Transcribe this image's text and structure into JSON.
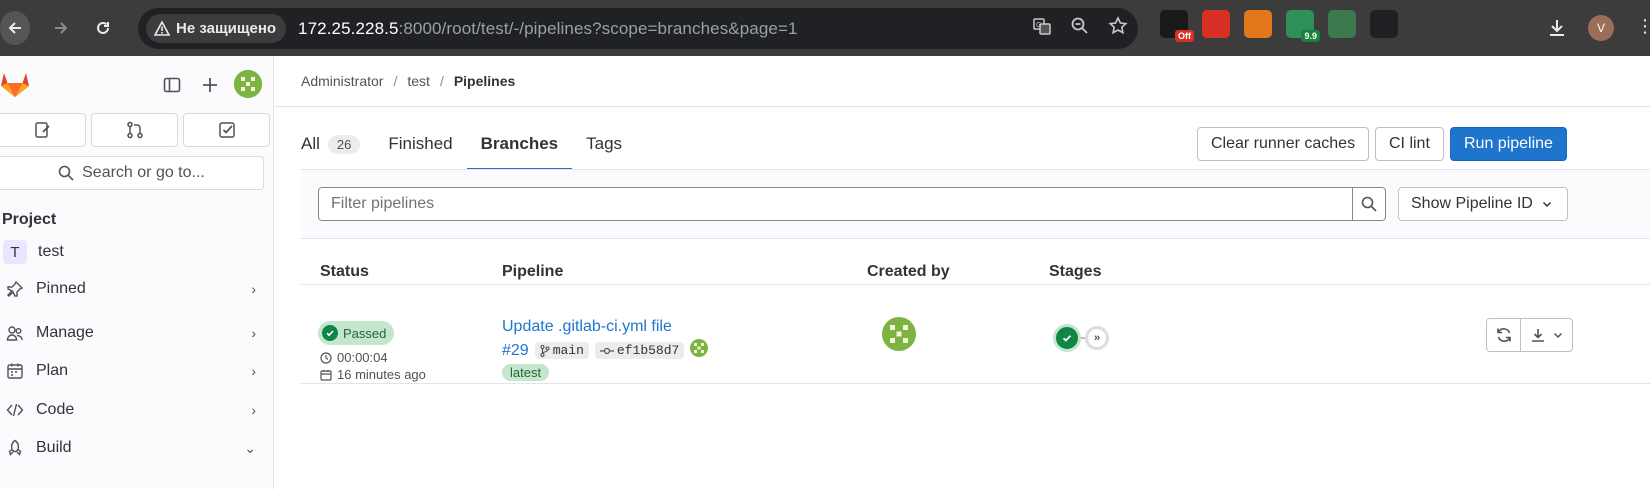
{
  "browser": {
    "insecure_label": "Не защищено",
    "url_host": "172.25.228.5",
    "url_rest": ":8000/root/test/-/pipelines?scope=branches&page=1",
    "extensions": [
      {
        "name": "off-extension",
        "badge": "Off",
        "color": "#1a1a1a",
        "badge_color": "#d93025"
      },
      {
        "name": "hand-extension",
        "color": "#d93025"
      },
      {
        "name": "metamask-extension",
        "color": "#e2761b"
      },
      {
        "name": "dino-extension",
        "badge": "9.9",
        "color": "#2f8f5b",
        "badge_color": "#188038"
      },
      {
        "name": "leaf-extension",
        "color": "#3a7a4c"
      },
      {
        "name": "info-extension",
        "color": "#202124"
      },
      {
        "name": "shield-extension",
        "color": "#3c3c3c"
      }
    ],
    "profile_initial": "V"
  },
  "sidebar": {
    "search_label": "Search or go to...",
    "section_title": "Project",
    "project_letter": "T",
    "project_name": "test",
    "items": [
      {
        "label": "Pinned",
        "icon": "pin-icon",
        "chevron": "›"
      },
      {
        "label": "Manage",
        "icon": "users-icon",
        "chevron": "›"
      },
      {
        "label": "Plan",
        "icon": "calendar-icon",
        "chevron": "›"
      },
      {
        "label": "Code",
        "icon": "code-icon",
        "chevron": "›"
      },
      {
        "label": "Build",
        "icon": "rocket-icon",
        "chevron": "⌄"
      }
    ]
  },
  "breadcrumb": [
    "Administrator",
    "test",
    "Pipelines"
  ],
  "tabs": [
    {
      "label": "All",
      "count": "26"
    },
    {
      "label": "Finished"
    },
    {
      "label": "Branches",
      "active": true
    },
    {
      "label": "Tags"
    }
  ],
  "buttons": {
    "clear_cache": "Clear runner caches",
    "ci_lint": "CI lint",
    "run_pipeline": "Run pipeline"
  },
  "filter": {
    "placeholder": "Filter pipelines",
    "show_id": "Show Pipeline ID"
  },
  "table": {
    "headers": [
      "Status",
      "Pipeline",
      "Created by",
      "Stages"
    ],
    "rows": [
      {
        "status": "Passed",
        "duration": "00:00:04",
        "finished": "16 minutes ago",
        "title": "Update .gitlab-ci.yml file",
        "id": "#29",
        "branch": "main",
        "commit": "ef1b58d7",
        "tag": "latest"
      }
    ]
  },
  "colors": {
    "accent": "#1f75cb",
    "success": "#108548",
    "success_bg": "#c3e6cd"
  }
}
